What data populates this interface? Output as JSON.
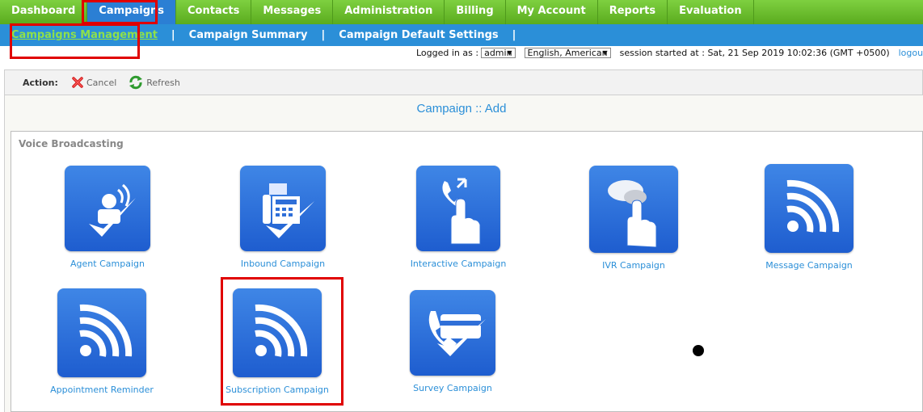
{
  "topnav": {
    "items": [
      {
        "label": "Dashboard",
        "active": false
      },
      {
        "label": "Campaigns",
        "active": true
      },
      {
        "label": "Contacts",
        "active": false
      },
      {
        "label": "Messages",
        "active": false
      },
      {
        "label": "Administration",
        "active": false
      },
      {
        "label": "Billing",
        "active": false
      },
      {
        "label": "My Account",
        "active": false
      },
      {
        "label": "Reports",
        "active": false
      },
      {
        "label": "Evaluation",
        "active": false
      }
    ]
  },
  "subnav": {
    "items": [
      {
        "label": "Campaigns Management",
        "active": true
      },
      {
        "label": "Campaign Summary",
        "active": false
      },
      {
        "label": "Campaign Default Settings",
        "active": false
      }
    ],
    "separator": "|"
  },
  "status": {
    "logged_in_label": "Logged in as :",
    "user": "admin",
    "language": "English, American",
    "session_text": "session started at : Sat, 21 Sep 2019 10:02:36 (GMT +0500)",
    "logout": "logout"
  },
  "actions": {
    "label": "Action:",
    "cancel": "Cancel",
    "refresh": "Refresh"
  },
  "page": {
    "title": "Campaign :: Add"
  },
  "panel": {
    "title": "Voice Broadcasting",
    "tiles": [
      {
        "label": "Agent Campaign",
        "icon": "agent-headset-icon"
      },
      {
        "label": "Inbound Campaign",
        "icon": "fax-phone-icon"
      },
      {
        "label": "Interactive Campaign",
        "icon": "phone-touch-icon"
      },
      {
        "label": "IVR Campaign",
        "icon": "speech-touch-icon"
      },
      {
        "label": "Message Campaign",
        "icon": "broadcast-icon"
      },
      {
        "label": "Appointment Reminder",
        "icon": "broadcast-icon"
      },
      {
        "label": "Subscription Campaign",
        "icon": "broadcast-icon"
      },
      {
        "label": "Survey Campaign",
        "icon": "phone-card-icon"
      }
    ]
  },
  "colors": {
    "nav_green": "#5aab1e",
    "sub_blue": "#2b8fd8",
    "highlight_red": "#e00000",
    "tile_blue": "#2f74de"
  }
}
